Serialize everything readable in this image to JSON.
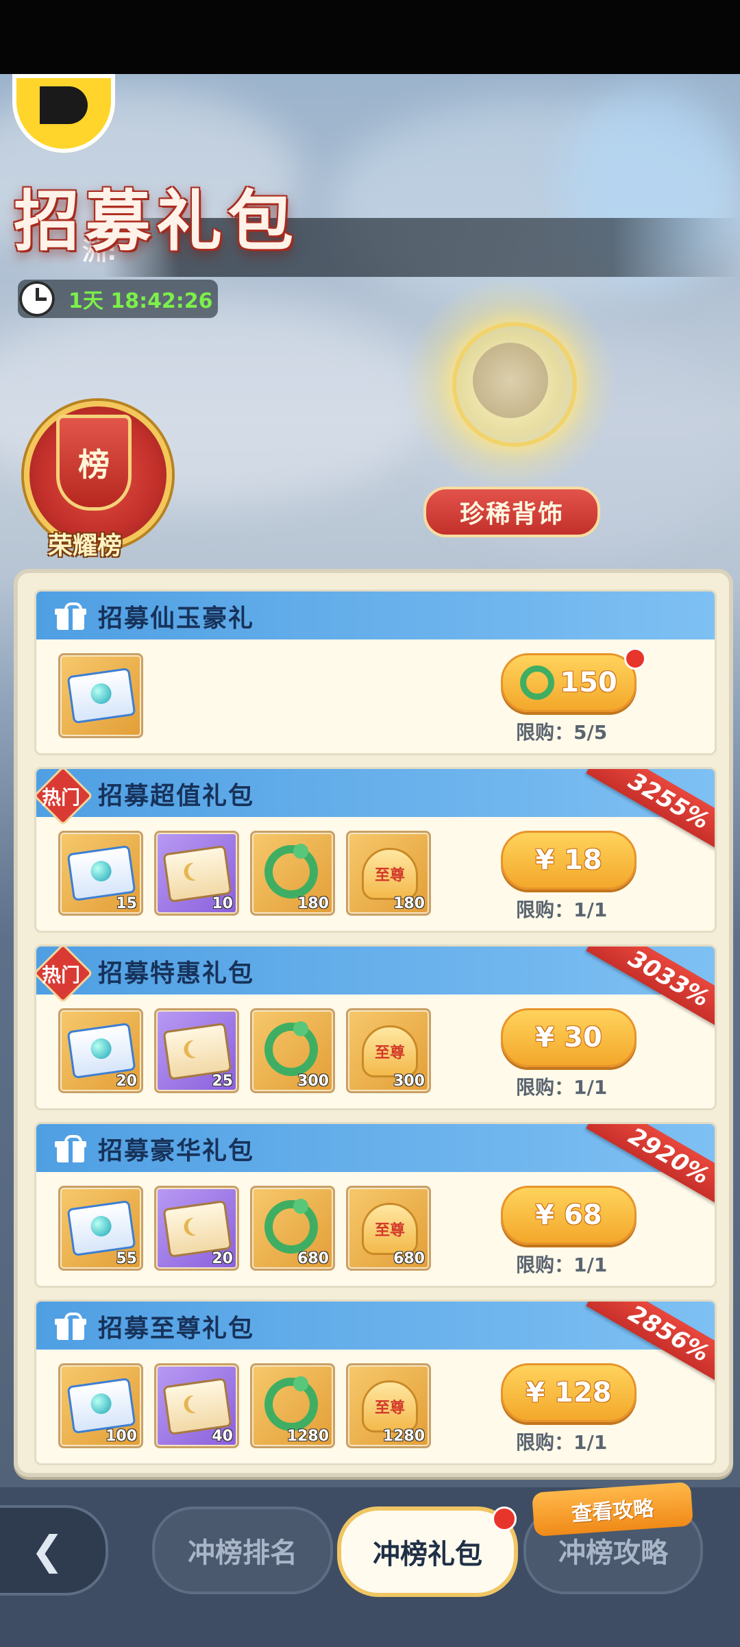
{
  "header": {
    "title": "招募礼包",
    "banner_text": "洲:",
    "countdown": "1天 18:42:26"
  },
  "showcase": {
    "rare_label": "珍稀背饰",
    "honor_label": "荣耀榜",
    "honor_badge_char": "榜"
  },
  "packages": [
    {
      "title": "招募仙玉豪礼",
      "badge": "",
      "discount": "",
      "price": "150",
      "price_type": "jade",
      "limit": "限购：5/5",
      "items": [
        {
          "kind": "scroll-blue",
          "qty": ""
        }
      ]
    },
    {
      "title": "招募超值礼包",
      "badge": "热门",
      "discount": "3255%",
      "price": "¥ 18",
      "price_type": "cash",
      "limit": "限购：1/1",
      "items": [
        {
          "kind": "scroll-blue",
          "qty": "15"
        },
        {
          "kind": "scroll-purple",
          "qty": "10"
        },
        {
          "kind": "dragon",
          "qty": "180"
        },
        {
          "kind": "supreme",
          "qty": "180"
        }
      ]
    },
    {
      "title": "招募特惠礼包",
      "badge": "热门",
      "discount": "3033%",
      "price": "¥ 30",
      "price_type": "cash",
      "limit": "限购：1/1",
      "items": [
        {
          "kind": "scroll-blue",
          "qty": "20"
        },
        {
          "kind": "scroll-purple",
          "qty": "25"
        },
        {
          "kind": "dragon",
          "qty": "300"
        },
        {
          "kind": "supreme",
          "qty": "300"
        }
      ]
    },
    {
      "title": "招募豪华礼包",
      "badge": "",
      "discount": "2920%",
      "price": "¥ 68",
      "price_type": "cash",
      "limit": "限购：1/1",
      "items": [
        {
          "kind": "scroll-blue",
          "qty": "55"
        },
        {
          "kind": "scroll-purple",
          "qty": "20"
        },
        {
          "kind": "dragon",
          "qty": "680"
        },
        {
          "kind": "supreme",
          "qty": "680"
        }
      ]
    },
    {
      "title": "招募至尊礼包",
      "badge": "",
      "discount": "2856%",
      "price": "¥ 128",
      "price_type": "cash",
      "limit": "限购：1/1",
      "items": [
        {
          "kind": "scroll-blue",
          "qty": "100"
        },
        {
          "kind": "scroll-purple",
          "qty": "40"
        },
        {
          "kind": "dragon",
          "qty": "1280"
        },
        {
          "kind": "supreme",
          "qty": "1280"
        }
      ]
    }
  ],
  "supreme_icon_text": "至尊",
  "bottom_nav": {
    "guide_tag": "查看攻略",
    "tabs": [
      "冲榜排名",
      "冲榜礼包",
      "冲榜攻略"
    ],
    "active": 1
  },
  "colors": {
    "header_blue": "#4f9fe3",
    "price_gold": "#f3a82b",
    "discount_red": "#d93b34",
    "timer_green": "#7cf04a"
  }
}
